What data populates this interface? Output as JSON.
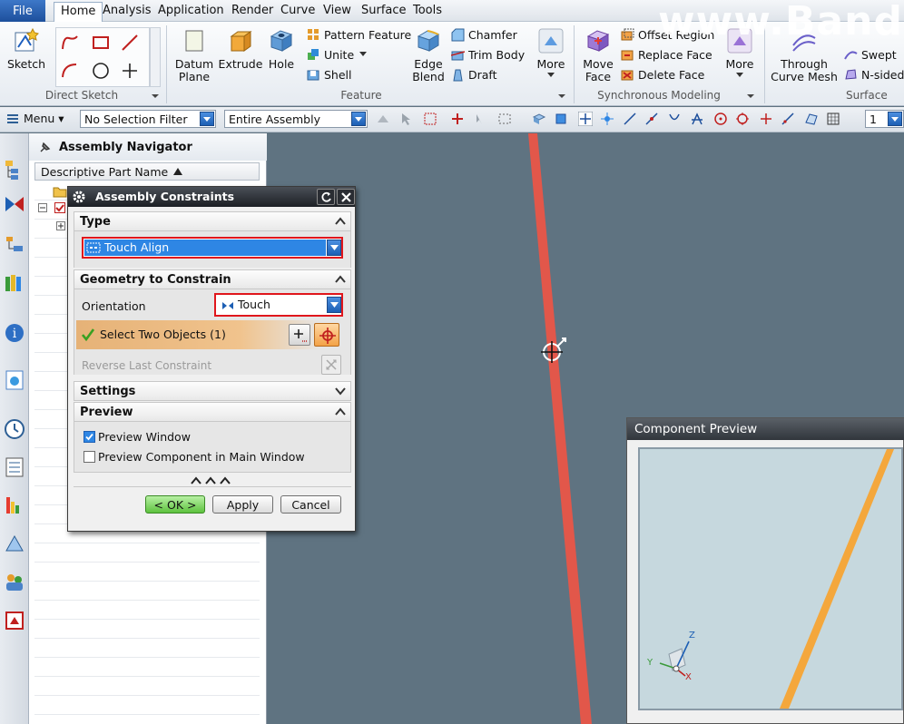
{
  "menubar": {
    "file": "File",
    "items": [
      "Home",
      "Analysis",
      "Application",
      "Render",
      "Curve",
      "View",
      "Surface",
      "Tools"
    ]
  },
  "ribbon": {
    "sketch": "Sketch",
    "direct_sketch_label": "Direct Sketch",
    "datum_plane": [
      "Datum",
      "Plane"
    ],
    "extrude": "Extrude",
    "hole": "Hole",
    "pattern_feature": "Pattern Feature",
    "unite": "Unite",
    "shell": "Shell",
    "edge_blend": [
      "Edge",
      "Blend"
    ],
    "chamfer": "Chamfer",
    "trim_body": "Trim Body",
    "draft": "Draft",
    "more": "More",
    "feature_label": "Feature",
    "move_face": [
      "Move",
      "Face"
    ],
    "offset_region": "Offset Region",
    "replace_face": "Replace Face",
    "delete_face": "Delete Face",
    "more2": "More",
    "sync_label": "Synchronous Modeling",
    "through_curve_mesh": [
      "Through",
      "Curve Mesh"
    ],
    "swept": "Swept",
    "n_sided": "N-sided",
    "surface_label": "Surface"
  },
  "toolbar": {
    "menu": "Menu",
    "selection_filter": "No Selection Filter",
    "assembly_scope": "Entire Assembly",
    "count": "1"
  },
  "navigator": {
    "title": "Assembly Navigator",
    "column": "Descriptive Part Name"
  },
  "watermark": "www.Bandi",
  "dialog": {
    "title": "Assembly Constraints",
    "type_header": "Type",
    "type_value": "Touch Align",
    "geometry_header": "Geometry to Constrain",
    "orientation_label": "Orientation",
    "orientation_value": "Touch",
    "select_label": "Select Two Objects (1)",
    "reverse_label": "Reverse Last Constraint",
    "settings_header": "Settings",
    "preview_header": "Preview",
    "preview_window": "Preview Window",
    "preview_window_checked": true,
    "preview_component": "Preview Component in Main Window",
    "preview_component_checked": false,
    "ok": "< OK >",
    "apply": "Apply",
    "cancel": "Cancel"
  },
  "preview": {
    "title": "Component Preview",
    "axes": {
      "x": "X",
      "y": "Y",
      "z": "Z"
    }
  },
  "colors": {
    "constraint_edge": "#e2574a",
    "preview_edge": "#f4a73c",
    "highlight_red": "#e0161c",
    "selection_blue": "#2e86e4",
    "viewport_bg": "#5f7381"
  }
}
